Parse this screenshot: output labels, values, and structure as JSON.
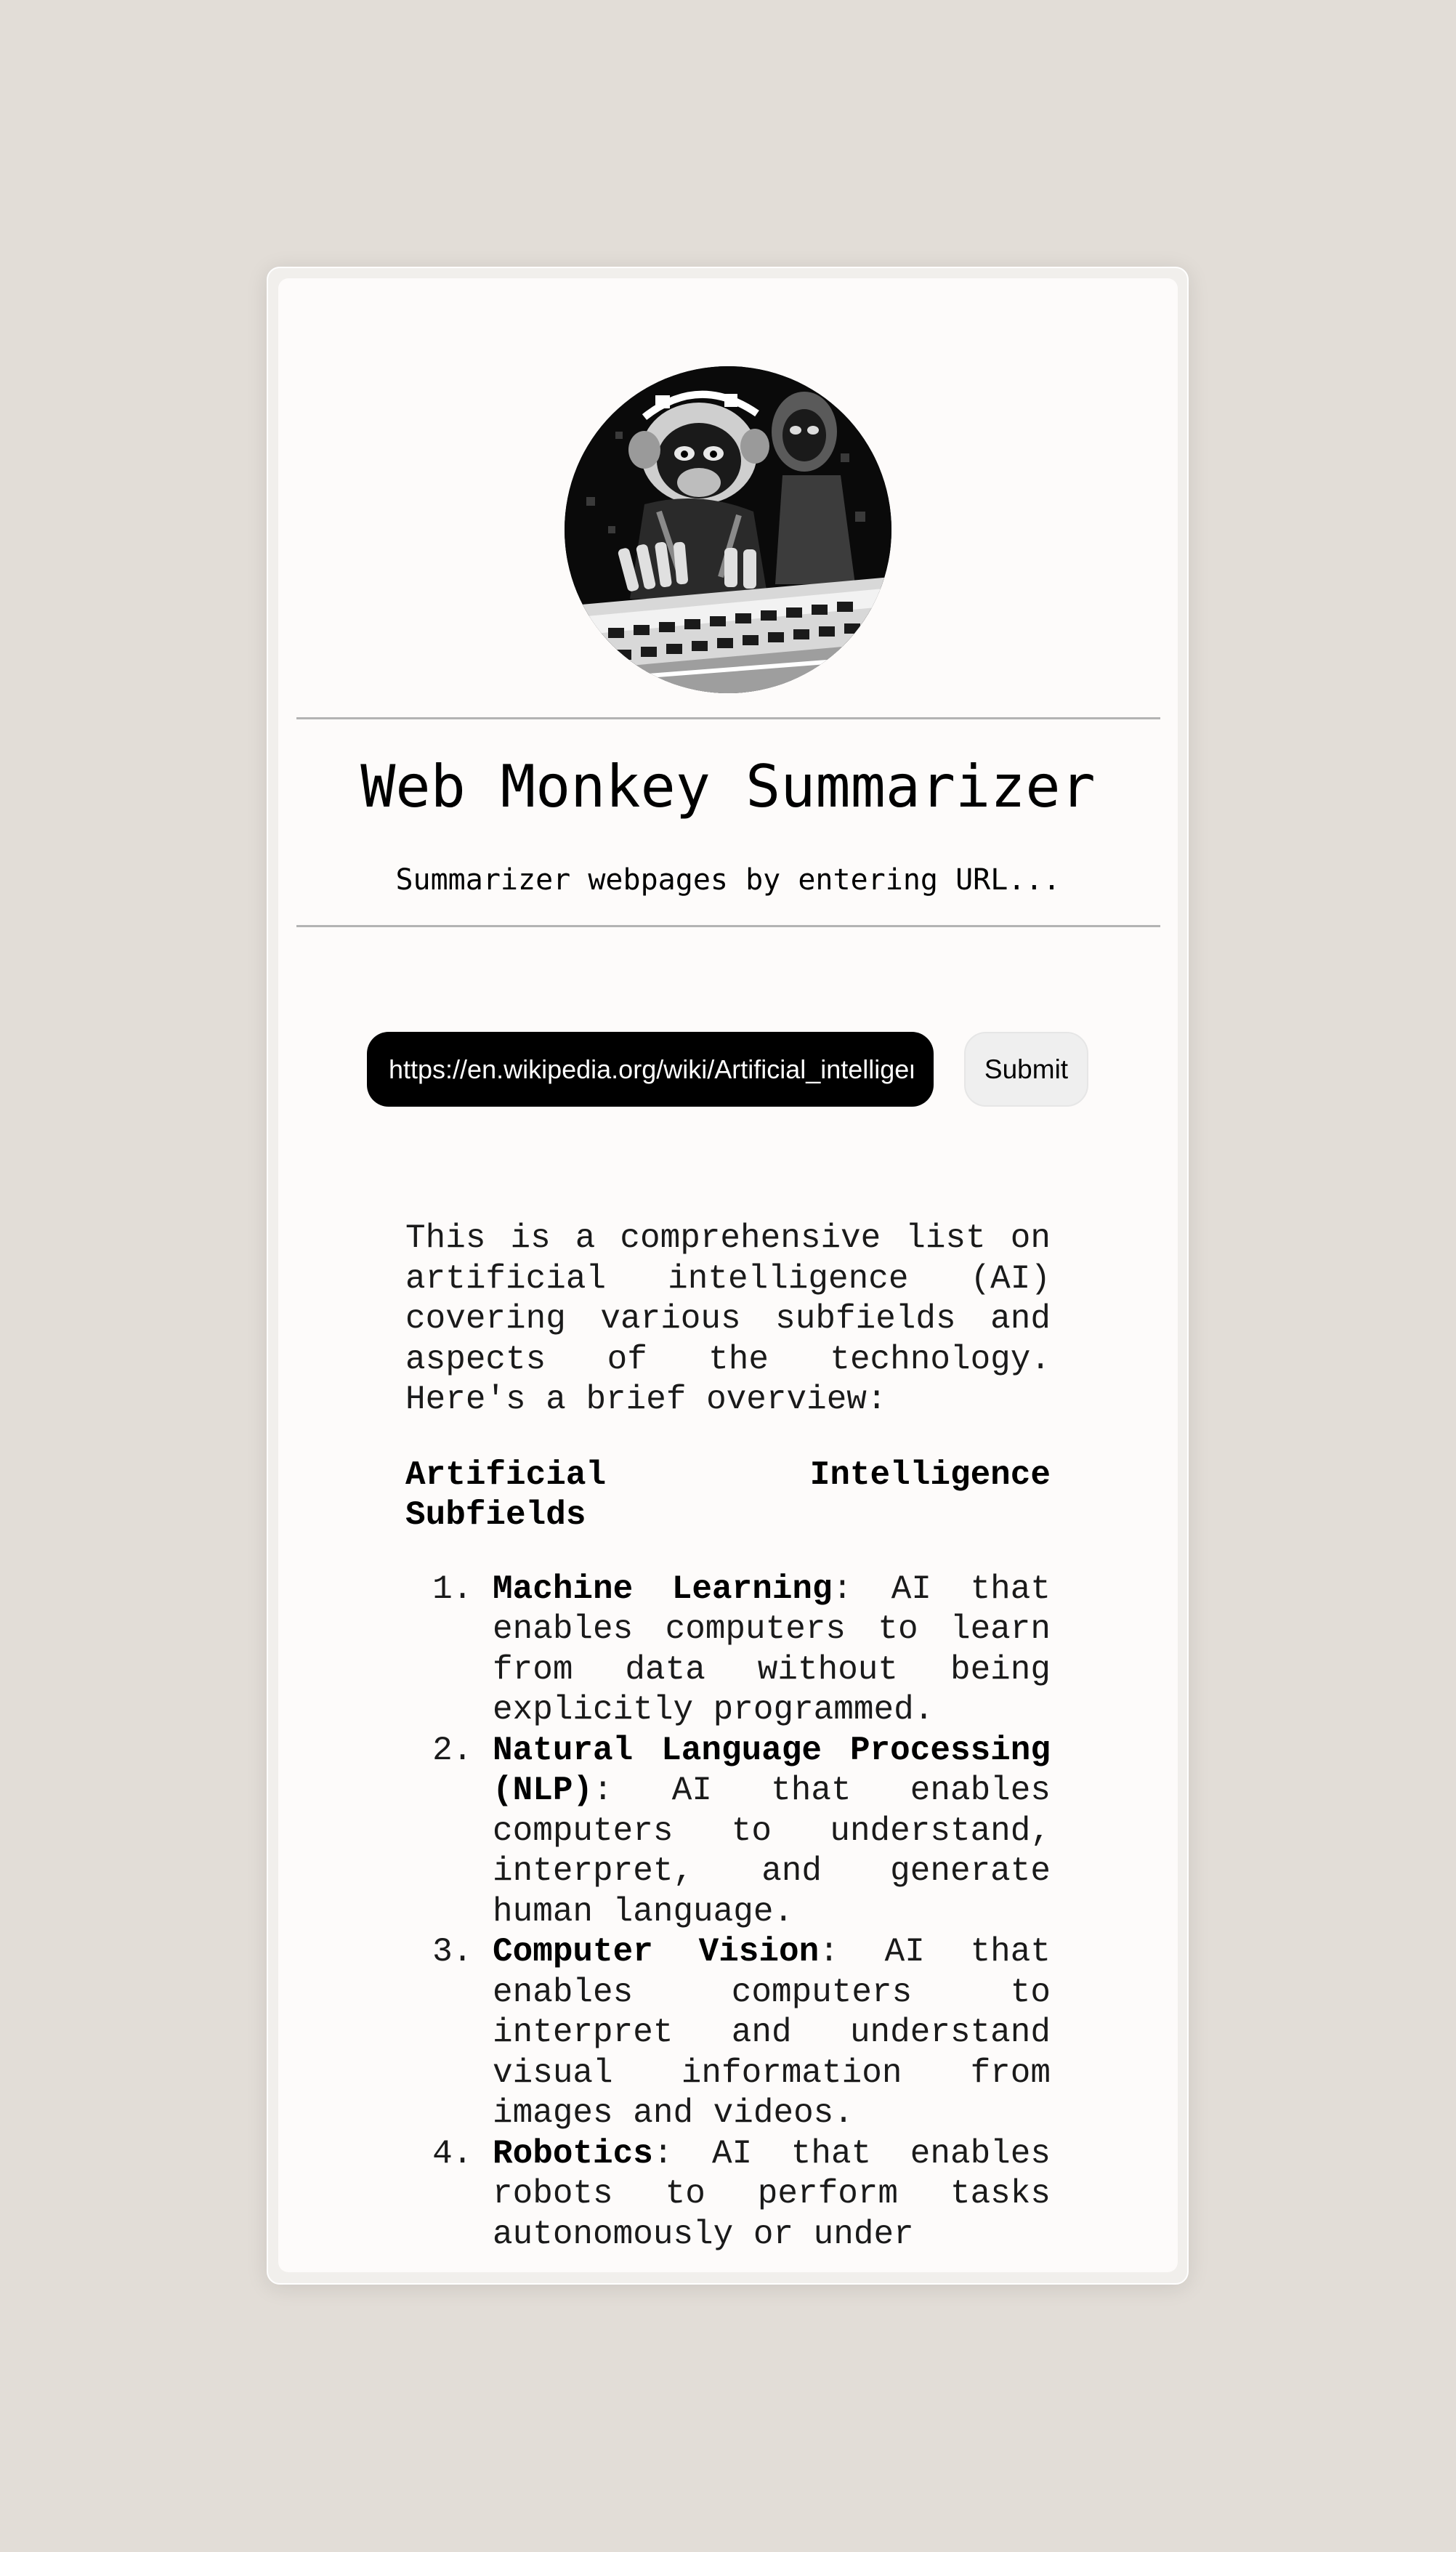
{
  "app": {
    "title": "Web Monkey Summarizer",
    "subtitle": "Summarizer webpages by entering URL..."
  },
  "avatar": {
    "icon": "monkey-typing-avatar"
  },
  "form": {
    "url_value": "https://en.wikipedia.org/wiki/Artificial_intelligence",
    "submit_label": "Submit"
  },
  "summary": {
    "intro": "This is a comprehensive list on artificial intelligence (AI) covering various subfields and aspects of the technology. Here's a brief overview:",
    "heading": "Artificial Intelligence Subfields",
    "items": [
      {
        "title": "Machine Learning",
        "text": ": AI that enables computers to learn from data without being explicitly programmed."
      },
      {
        "title": "Natural Language Processing (NLP)",
        "text": ": AI that enables computers to understand, interpret, and generate human language."
      },
      {
        "title": "Computer Vision",
        "text": ": AI that enables computers to interpret and understand visual information from images and videos."
      },
      {
        "title": "Robotics",
        "text": ": AI that enables robots to perform tasks autonomously or under"
      }
    ]
  }
}
